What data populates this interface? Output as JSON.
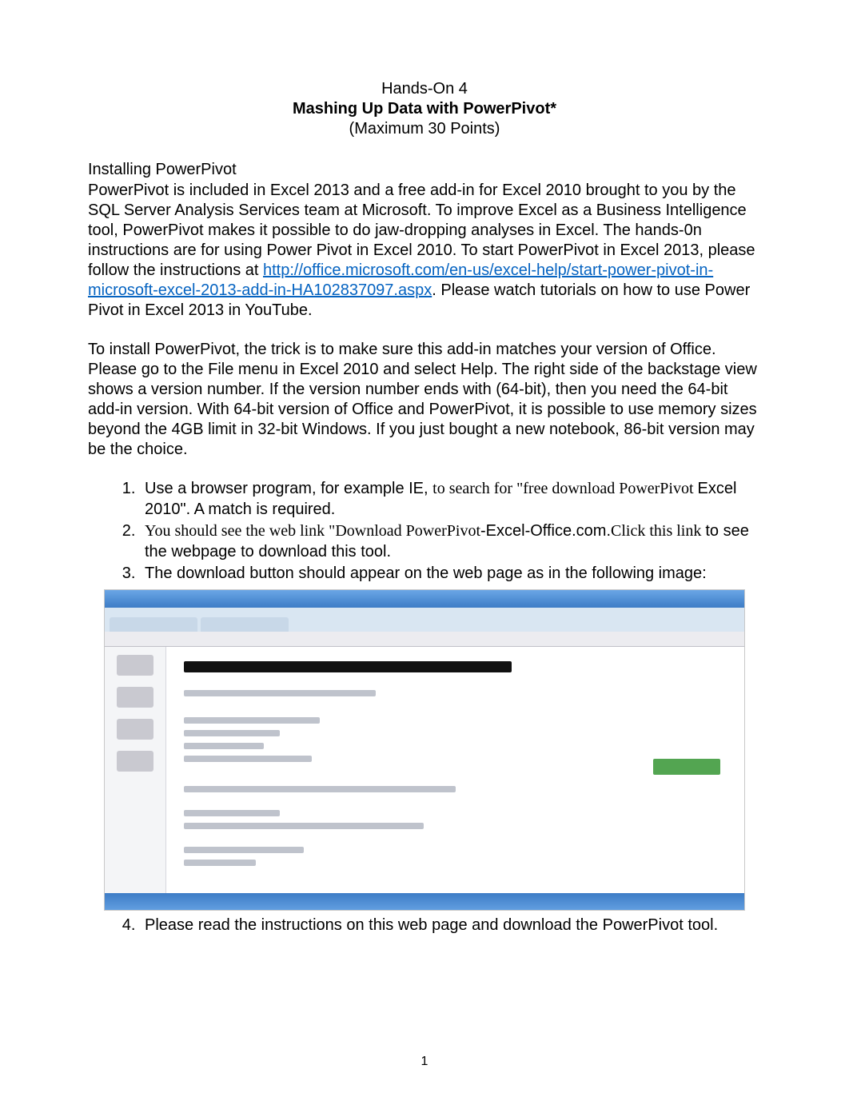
{
  "header": {
    "line1": "Hands-On 4",
    "line2": "Mashing Up Data with PowerPivot*",
    "line3": "(Maximum 30 Points)"
  },
  "section1": {
    "subtitle": "Installing PowerPivot",
    "p1_a": "PowerPivot is included in Excel 2013 and a free add-in for Excel 2010 brought to you by the SQL Server Analysis Services team at Microsoft. To improve Excel as a Business Intelligence tool, PowerPivot makes it possible to do jaw-dropping analyses in Excel. The hands-0n instructions are for using Power Pivot in Excel 2010. To start PowerPivot in Excel 2013, please follow the instructions at ",
    "p1_link": "http://office.microsoft.com/en-us/excel-help/start-power-pivot-in-microsoft-excel-2013-add-in-HA102837097.aspx",
    "p1_b": ". Please watch tutorials on how to use Power Pivot in Excel 2013 in YouTube."
  },
  "section2": {
    "p2": "To install PowerPivot, the trick is to make sure this add-in matches your version of Office. Please go to the File menu in Excel 2010 and select Help. The right side of the backstage view shows a version number. If the version number ends with (64-bit), then you need the 64-bit add-in version. With 64-bit version of Office and PowerPivot, it is possible to use memory sizes beyond the 4GB limit in 32-bit Windows. If you just bought a new notebook, 86-bit version may be the choice."
  },
  "list": {
    "i1_a": "Use a browser program, for example IE, ",
    "i1_b": "to search for \"free download PowerPivot ",
    "i1_c": "Excel 2010\". A match is required.",
    "i2_a": "You should see the web link \"Download PowerPivot",
    "i2_b": "-Excel-Office.com.",
    "i2_c": "Click this link ",
    "i2_d": "to see the webpage to download this tool.",
    "i3": "The download button should appear on the web page as in the following image:",
    "i4": "Please read the instructions on this web page and download the PowerPivot tool."
  },
  "pagenum": "1"
}
